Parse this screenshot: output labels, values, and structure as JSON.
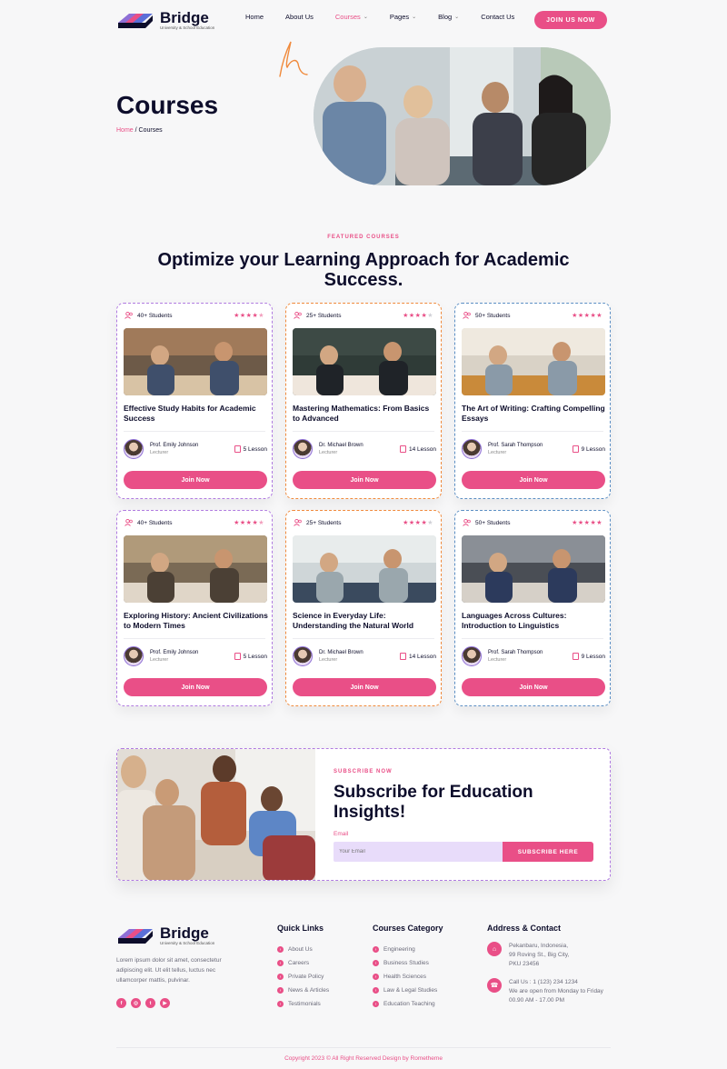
{
  "brand": {
    "name": "Bridge",
    "tagline": "University & School Education"
  },
  "nav": {
    "items": [
      {
        "label": "Home"
      },
      {
        "label": "About Us"
      },
      {
        "label": "Courses",
        "dropdown": true,
        "active": true
      },
      {
        "label": "Pages",
        "dropdown": true
      },
      {
        "label": "Blog",
        "dropdown": true
      },
      {
        "label": "Contact Us"
      }
    ],
    "cta": "JOIN US NOW"
  },
  "hero": {
    "title": "Courses",
    "breadcrumb": {
      "home": "Home",
      "separator": " / ",
      "current": "Courses"
    }
  },
  "featured": {
    "tag": "FEATURED COURSES",
    "title": "Optimize your Learning Approach for Academic Success."
  },
  "courses": [
    {
      "students": "40+ Students",
      "rating": 4.5,
      "title": "Effective Study Habits for Academic Success",
      "author": "Prof. Emily Johnson",
      "role": "Lecturer",
      "lessons": "5 Lesson",
      "button": "Join Now",
      "border": "purple"
    },
    {
      "students": "25+ Students",
      "rating": 4,
      "title": "Mastering Mathematics: From Basics to Advanced",
      "author": "Dr. Michael Brown",
      "role": "Lecturer",
      "lessons": "14 Lesson",
      "button": "Join Now",
      "border": "orange"
    },
    {
      "students": "50+ Students",
      "rating": 5,
      "title": "The Art of Writing: Crafting Compelling Essays",
      "author": "Prof. Sarah Thompson",
      "role": "Lecturer",
      "lessons": "9 Lesson",
      "button": "Join Now",
      "border": "blue"
    },
    {
      "students": "40+ Students",
      "rating": 4.5,
      "title": "Exploring History: Ancient Civilizations to Modern Times",
      "author": "Prof. Emily Johnson",
      "role": "Lecturer",
      "lessons": "5 Lesson",
      "button": "Join Now",
      "border": "purple"
    },
    {
      "students": "25+ Students",
      "rating": 4,
      "title": "Science in Everyday Life: Understanding the Natural World",
      "author": "Dr. Michael Brown",
      "role": "Lecturer",
      "lessons": "14 Lesson",
      "button": "Join Now",
      "border": "orange"
    },
    {
      "students": "50+ Students",
      "rating": 5,
      "title": "Languages Across Cultures: Introduction to Linguistics",
      "author": "Prof. Sarah Thompson",
      "role": "Lecturer",
      "lessons": "9 Lesson",
      "button": "Join Now",
      "border": "blue"
    }
  ],
  "subscribe": {
    "tag": "SUBSCRIBE NOW",
    "title": "Subscribe for Education Insights!",
    "email_label": "Email",
    "email_placeholder": "Your Email",
    "button": "SUBSCRIBE HERE"
  },
  "footer": {
    "about": "Lorem ipsum dolor sit amet, consectetur adipiscing elit. Ut elit tellus, luctus nec ullamcorper mattis, pulvinar.",
    "quick_links": {
      "title": "Quick Links",
      "items": [
        "About Us",
        "Careers",
        "Private Policy",
        "News & Articles",
        "Testimonials"
      ]
    },
    "categories": {
      "title": "Courses Category",
      "items": [
        "Engineering",
        "Business Studies",
        "Health Sciences",
        "Law & Legal Studies",
        "Education Teaching"
      ]
    },
    "contact": {
      "title": "Address & Contact",
      "address_lines": [
        "Pekanbaru, Indonesia,",
        "99 Roving St., Big City,",
        "PKU 23456"
      ],
      "call_lines": [
        "Call Us : 1 (123) 234 1234",
        "We are open from Monday to Friday",
        "00.90 AM - 17.00 PM"
      ]
    },
    "copyright": "Copyright 2023 © All Right Reserved Design by Rometheme"
  },
  "colors": {
    "accent": "#e94f87",
    "navy": "#0d0d2b",
    "purple": "#b07be0",
    "orange": "#f08a3c",
    "blue": "#5c8fc4",
    "email_bg": "#e8dcfa"
  }
}
